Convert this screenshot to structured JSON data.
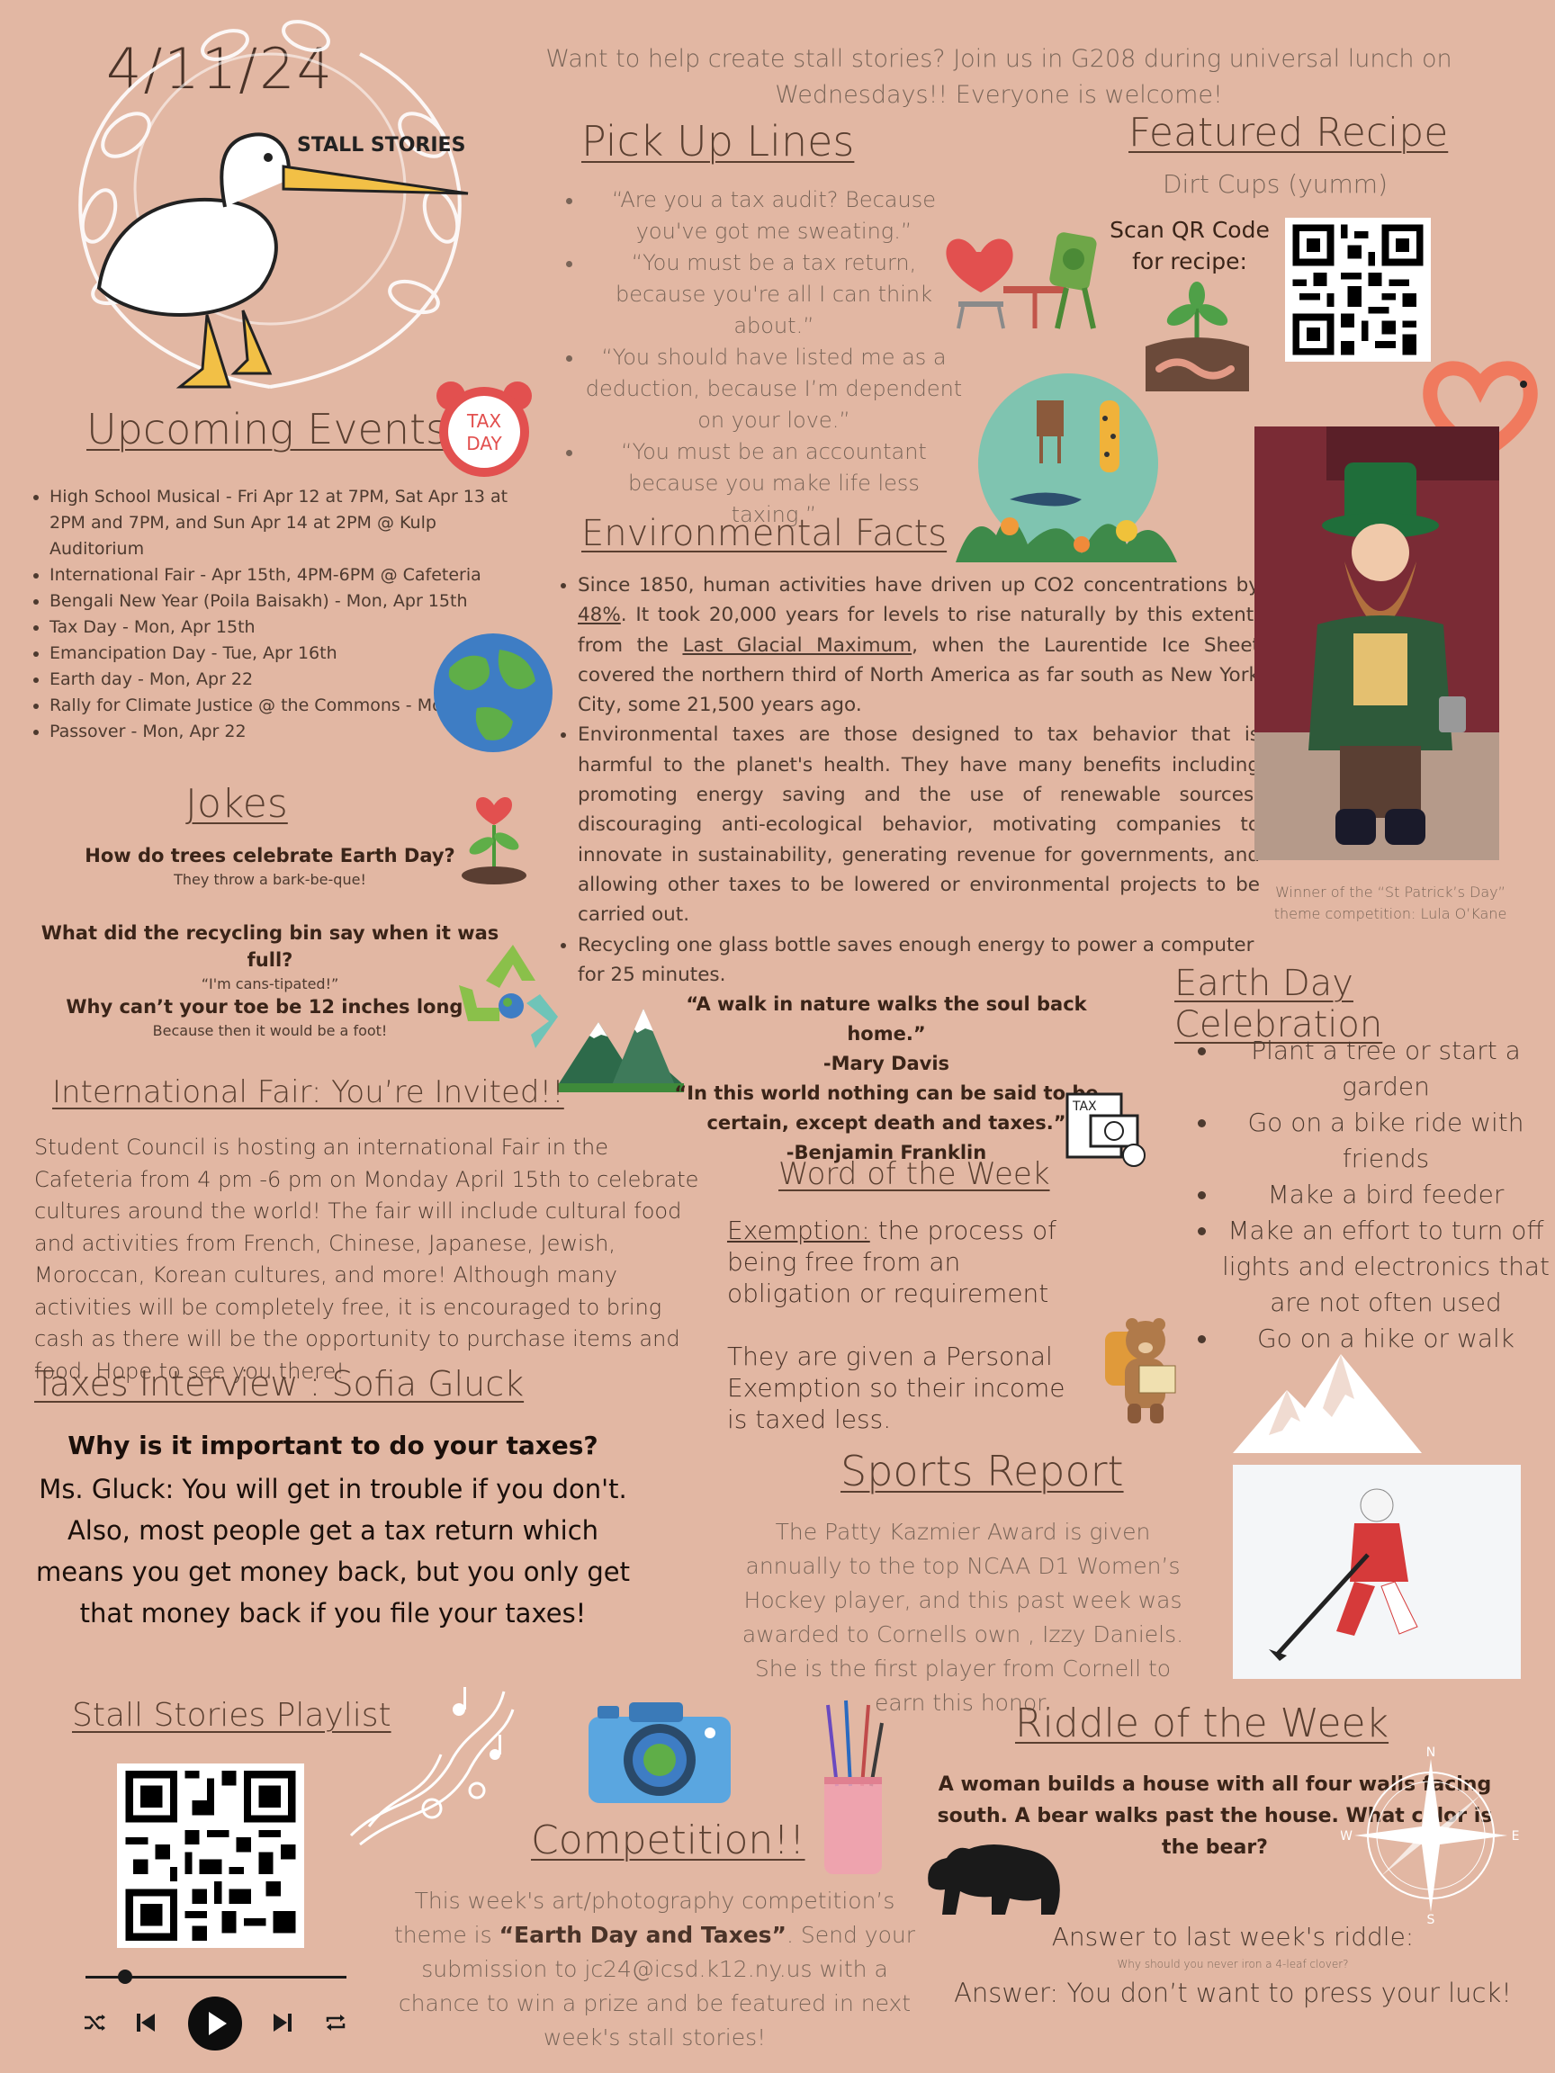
{
  "date": "4/11/24",
  "logo_text": "STALL STORIES",
  "invite": "Want to help create stall stories? Join us in G208 during universal lunch on Wednesdays!! Everyone is welcome!",
  "pickup": {
    "title": "Pick Up Lines",
    "items": [
      "“Are you a tax audit? Because you've got me sweating.”",
      "“You must be a tax return, because you're all I can think about.”",
      "“You should have listed me as a deduction, because I’m dependent on your love.”",
      "“You must be an accountant because you make life less taxing.”"
    ]
  },
  "recipe": {
    "title": "Featured Recipe",
    "name": "Dirt Cups (yumm)",
    "scan": "Scan QR Code for recipe:"
  },
  "events": {
    "title": "Upcoming Events",
    "items": [
      "High School Musical - Fri Apr 12 at 7PM, Sat Apr 13 at 2PM and 7PM, and Sun Apr 14 at 2PM @ Kulp Auditorium",
      "International Fair - Apr 15th, 4PM-6PM @ Cafeteria",
      "Bengali New Year (Poila Baisakh) - Mon, Apr 15th",
      "Tax Day - Mon, Apr 15th",
      "Emancipation Day - Tue, Apr 16th",
      "Earth day - Mon, Apr 22",
      "Rally for Climate Justice @ the Commons - Mon, Apr 22",
      "Passover - Mon, Apr 22"
    ]
  },
  "taxday_badge": [
    "TAX",
    "DAY"
  ],
  "env": {
    "title": "Environmental Facts",
    "fact1": {
      "a": "Since 1850, human activities have driven up CO2 concentrations by ",
      "link1": "48%",
      "b": ". It took 20,000 years for levels to rise naturally by this extent, from the ",
      "link2": "Last Glacial Maximum",
      "c": ", when the Laurentide Ice Sheet covered the northern third of North America as far south as New York City, some 21,500 years ago."
    },
    "fact2": "Environmental taxes are those designed to tax behavior that is harmful to the planet's health. They have many benefits including promoting energy saving and the use of renewable sources, discouraging anti-ecological behavior, motivating companies to innovate in sustainability, generating revenue for governments, and allowing other taxes to be lowered or environmental projects to be carried out.",
    "fact3": "Recycling one glass bottle saves enough energy to power a computer for 25 minutes."
  },
  "winner_caption": "Winner of the “St Patrick’s Day” theme competition: Lula O’Kane",
  "jokes": {
    "title": "Jokes",
    "items": [
      {
        "q": "How do trees celebrate Earth Day?",
        "a": "They throw a bark-be-que!"
      },
      {
        "q": "What did the recycling bin say when it was full?",
        "a": "“I'm cans-tipated!”"
      },
      {
        "q": "Why can’t your toe be 12 inches long?",
        "a": "Because then it would be a foot!"
      }
    ]
  },
  "quotes": {
    "q1": "“A walk in nature walks the soul back home.”",
    "a1": "-Mary Davis",
    "q2": "“In this world nothing can be said to be certain, except death and taxes.”",
    "a2": "-Benjamin Franklin"
  },
  "tax_icon_label": "TAX",
  "earthday": {
    "title": "Earth Day Celebration",
    "items": [
      "Plant a tree or start a garden",
      "Go on a bike ride with friends",
      "Make a bird feeder",
      "Make an effort to turn off lights and electronics that are not often used",
      "Go on a hike or walk"
    ]
  },
  "fair": {
    "title": "International Fair: You’re Invited!!",
    "body": "Student Council is hosting an international Fair in the Cafeteria from 4 pm -6 pm on Monday April 15th to celebrate cultures around the world! The fair will include cultural food and activities from French, Chinese, Japanese, Jewish, Moroccan, Korean cultures, and more! Although many activities will be completely free, it is encouraged to bring cash as there will be the opportunity to purchase items and food. Hope to see you there!"
  },
  "word": {
    "title": "Word of the Week",
    "term": "Exemption:",
    "definition": " the process of being free from an obligation or requirement",
    "example": "They are given a Personal Exemption so their income is taxed less."
  },
  "interview": {
    "title": "Taxes Interview : Sofia Gluck",
    "question": "Why is it important to do your taxes?",
    "answer": "Ms. Gluck: You will get in trouble if you don't. Also, most people get a tax return which means you get money back, but you only get that money back if you file your taxes!"
  },
  "sports": {
    "title": "Sports Report",
    "body": "The Patty Kazmier Award is given annually to the top NCAA D1 Women’s Hockey player, and this past week was awarded to Cornells own , Izzy Daniels. She is the first player from Cornell to earn this honor."
  },
  "playlist": {
    "title": "Stall Stories Playlist",
    "progress": 0.15
  },
  "competition": {
    "title": "Competition!!",
    "a": "This week's art/photography competition’s theme is ",
    "theme": "“Earth Day and Taxes”",
    "b": ". Send your submission to jc24@icsd.k12.ny.us with a chance to win a prize and be featured in next week's stall stories!"
  },
  "riddle": {
    "title": "Riddle of the Week",
    "question": "A woman builds a house with all four walls facing south. A bear walks past the house. What color is the bear?",
    "last_label": "Answer to last week's riddle:",
    "last_q": "Why should you never iron a 4-leaf clover?",
    "last_a": "Answer: You don’t want to press your luck!"
  },
  "compass": {
    "n": "N",
    "s": "S",
    "e": "E",
    "w": "W"
  }
}
